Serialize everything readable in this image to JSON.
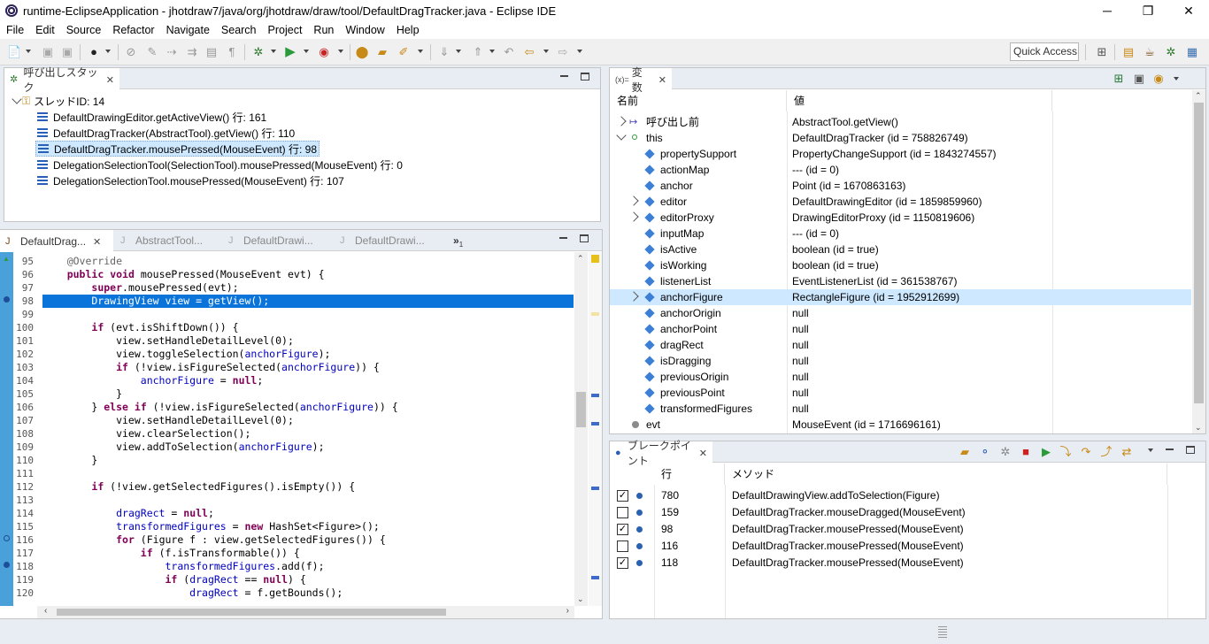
{
  "window": {
    "title": "runtime-EclipseApplication - jhotdraw7/java/org/jhotdraw/draw/tool/DefaultDragTracker.java - Eclipse IDE",
    "minimize": "─",
    "restore": "❐",
    "close": "✕"
  },
  "menu": [
    "File",
    "Edit",
    "Source",
    "Refactor",
    "Navigate",
    "Search",
    "Project",
    "Run",
    "Window",
    "Help"
  ],
  "toolbar": {
    "quick_access": "Quick Access"
  },
  "callstack": {
    "tab_label": "呼び出しスタック",
    "thread": "スレッドID: 14",
    "frames": [
      "DefaultDrawingEditor.getActiveView() 行: 161",
      "DefaultDragTracker(AbstractTool).getView() 行: 110",
      "DefaultDragTracker.mousePressed(MouseEvent) 行: 98",
      "DelegationSelectionTool(SelectionTool).mousePressed(MouseEvent) 行: 0",
      "DelegationSelectionTool.mousePressed(MouseEvent) 行: 107"
    ]
  },
  "editor": {
    "tabs": [
      "DefaultDrag...",
      "AbstractTool...",
      "DefaultDrawi...",
      "DefaultDrawi..."
    ],
    "overflow": "»",
    "overflow_count": "1",
    "line_numbers": [
      "95",
      "96",
      "97",
      "98",
      "99",
      "100",
      "101",
      "102",
      "103",
      "104",
      "105",
      "106",
      "107",
      "108",
      "109",
      "110",
      "111",
      "112",
      "113",
      "114",
      "115",
      "116",
      "117",
      "118",
      "119",
      "120"
    ],
    "current_line": "98"
  },
  "variables": {
    "tab_prefix": "(x)=",
    "tab_label": "変数",
    "col_name": "名前",
    "col_value": "値",
    "rows": [
      {
        "name": "呼び出し前",
        "value": "AbstractTool.getView()"
      },
      {
        "name": "this",
        "value": "DefaultDragTracker (id = 758826749)"
      },
      {
        "name": "propertySupport",
        "value": "PropertyChangeSupport (id = 1843274557)"
      },
      {
        "name": "actionMap",
        "value": "--- (id = 0)"
      },
      {
        "name": "anchor",
        "value": "Point (id = 1670863163)"
      },
      {
        "name": "editor",
        "value": "DefaultDrawingEditor (id = 1859859960)"
      },
      {
        "name": "editorProxy",
        "value": "DrawingEditorProxy (id = 1150819606)"
      },
      {
        "name": "inputMap",
        "value": "--- (id = 0)"
      },
      {
        "name": "isActive",
        "value": "boolean (id = true)"
      },
      {
        "name": "isWorking",
        "value": "boolean (id = true)"
      },
      {
        "name": "listenerList",
        "value": "EventListenerList (id = 361538767)"
      },
      {
        "name": "anchorFigure",
        "value": "RectangleFigure (id = 1952912699)"
      },
      {
        "name": "anchorOrigin",
        "value": "null"
      },
      {
        "name": "anchorPoint",
        "value": "null"
      },
      {
        "name": "dragRect",
        "value": "null"
      },
      {
        "name": "isDragging",
        "value": "null"
      },
      {
        "name": "previousOrigin",
        "value": "null"
      },
      {
        "name": "previousPoint",
        "value": "null"
      },
      {
        "name": "transformedFigures",
        "value": "null"
      },
      {
        "name": "evt",
        "value": "MouseEvent (id = 1716696161)"
      }
    ]
  },
  "breakpoints": {
    "tab_label": "ブレークポイント",
    "col_line": "行",
    "col_method": "メソッド",
    "rows": [
      {
        "line": "780",
        "method": "DefaultDrawingView.addToSelection(Figure)",
        "checked": true
      },
      {
        "line": "159",
        "method": "DefaultDragTracker.mouseDragged(MouseEvent)",
        "checked": false
      },
      {
        "line": "98",
        "method": "DefaultDragTracker.mousePressed(MouseEvent)",
        "checked": true
      },
      {
        "line": "116",
        "method": "DefaultDragTracker.mousePressed(MouseEvent)",
        "checked": false
      },
      {
        "line": "118",
        "method": "DefaultDragTracker.mousePressed(MouseEvent)",
        "checked": true
      }
    ]
  }
}
